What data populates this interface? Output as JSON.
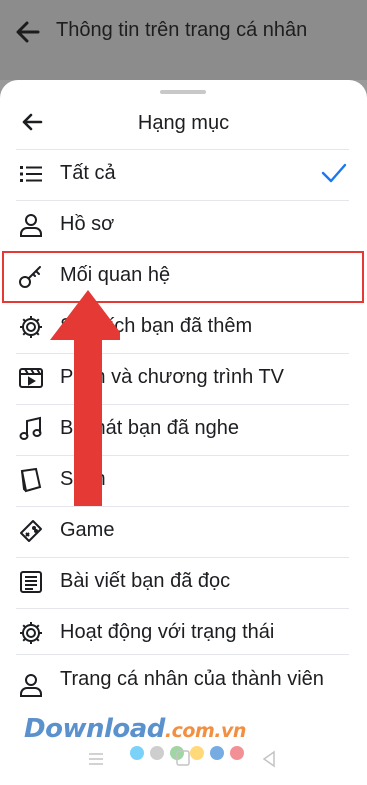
{
  "topbar": {
    "title": "Thông tin trên trang cá nhân"
  },
  "sheet": {
    "title": "Hạng mục"
  },
  "items": [
    {
      "label": "Tất cả",
      "icon": "list-icon",
      "selected": true
    },
    {
      "label": "Hồ sơ",
      "icon": "person-icon"
    },
    {
      "label": "Mối quan hệ",
      "icon": "key-icon",
      "highlighted": true
    },
    {
      "label": "Sở thích bạn đã thêm",
      "icon": "gear-icon"
    },
    {
      "label": "Phim và chương trình TV",
      "icon": "film-icon"
    },
    {
      "label": "Bài hát bạn đã nghe",
      "icon": "music-note-icon"
    },
    {
      "label": "Sách",
      "icon": "book-icon"
    },
    {
      "label": "Game",
      "icon": "gamepad-icon"
    },
    {
      "label": "Bài viết bạn đã đọc",
      "icon": "article-icon"
    },
    {
      "label": "Hoạt động với trạng thái",
      "icon": "gear-icon"
    },
    {
      "label": "Trang cá nhân của thành viên",
      "icon": "person-icon"
    }
  ],
  "watermark": {
    "text": "Download",
    "suffix": ".com.vn"
  },
  "colors": {
    "accent": "#1877f2",
    "highlight": "#e53935",
    "dots": [
      "#4fc3f7",
      "#bdbdbd",
      "#81c784",
      "#ffcc4d",
      "#4a90d9",
      "#ef6b73"
    ]
  }
}
